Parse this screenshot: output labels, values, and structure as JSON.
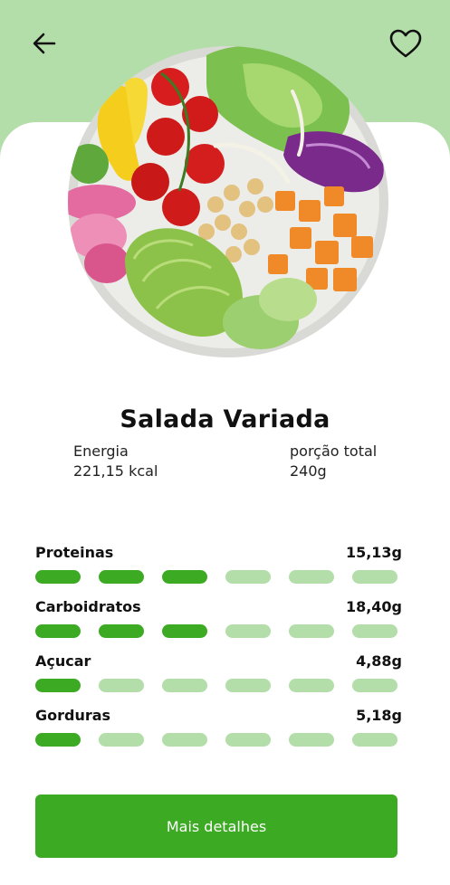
{
  "header": {
    "back_icon": "arrow-left-icon",
    "favorite_icon": "heart-outline-icon"
  },
  "dish": {
    "title": "Salada Variada",
    "image": "salad-bowl-illustration"
  },
  "stats": {
    "energy_label": "Energia",
    "energy_value": "221,15 kcal",
    "portion_label": "porção total",
    "portion_value": "240g"
  },
  "nutrients": [
    {
      "name": "Proteinas",
      "value": "15,13g",
      "level": 3,
      "max": 6
    },
    {
      "name": "Carboidratos",
      "value": "18,40g",
      "level": 3,
      "max": 6
    },
    {
      "name": "Açucar",
      "value": "4,88g",
      "level": 1,
      "max": 6
    },
    {
      "name": "Gorduras",
      "value": "5,18g",
      "level": 1,
      "max": 6
    }
  ],
  "actions": {
    "details_label": "Mais detalhes"
  },
  "colors": {
    "header_bg": "#b3dea9",
    "accent": "#3caa22",
    "inactive_segment": "#b3dea9"
  }
}
